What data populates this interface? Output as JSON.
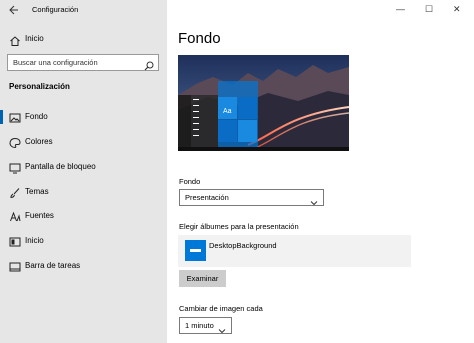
{
  "window": {
    "title": "Configuración",
    "minimize": "—",
    "maximize": "☐",
    "close": "✕"
  },
  "sidebar": {
    "home_label": "Inicio",
    "search_placeholder": "Buscar una configuración",
    "section_title": "Personalización",
    "items": [
      {
        "label": "Fondo",
        "icon": "picture-icon",
        "active": true
      },
      {
        "label": "Colores",
        "icon": "palette-icon"
      },
      {
        "label": "Pantalla de bloqueo",
        "icon": "lock-screen-icon"
      },
      {
        "label": "Temas",
        "icon": "brush-icon"
      },
      {
        "label": "Fuentes",
        "icon": "font-icon"
      },
      {
        "label": "Inicio",
        "icon": "start-icon"
      },
      {
        "label": "Barra de tareas",
        "icon": "taskbar-icon"
      }
    ]
  },
  "main": {
    "title": "Fondo",
    "preview_tile_text": "Aa",
    "background_label": "Fondo",
    "background_value": "Presentación",
    "albums_label": "Elegir álbumes para la presentación",
    "album_name": "DesktopBackground",
    "browse_button": "Examinar",
    "change_every_label": "Cambiar de imagen cada",
    "change_every_value": "1 minuto"
  },
  "colors": {
    "accent": "#0078d7",
    "sidebar_bg": "#e6e6e6"
  }
}
